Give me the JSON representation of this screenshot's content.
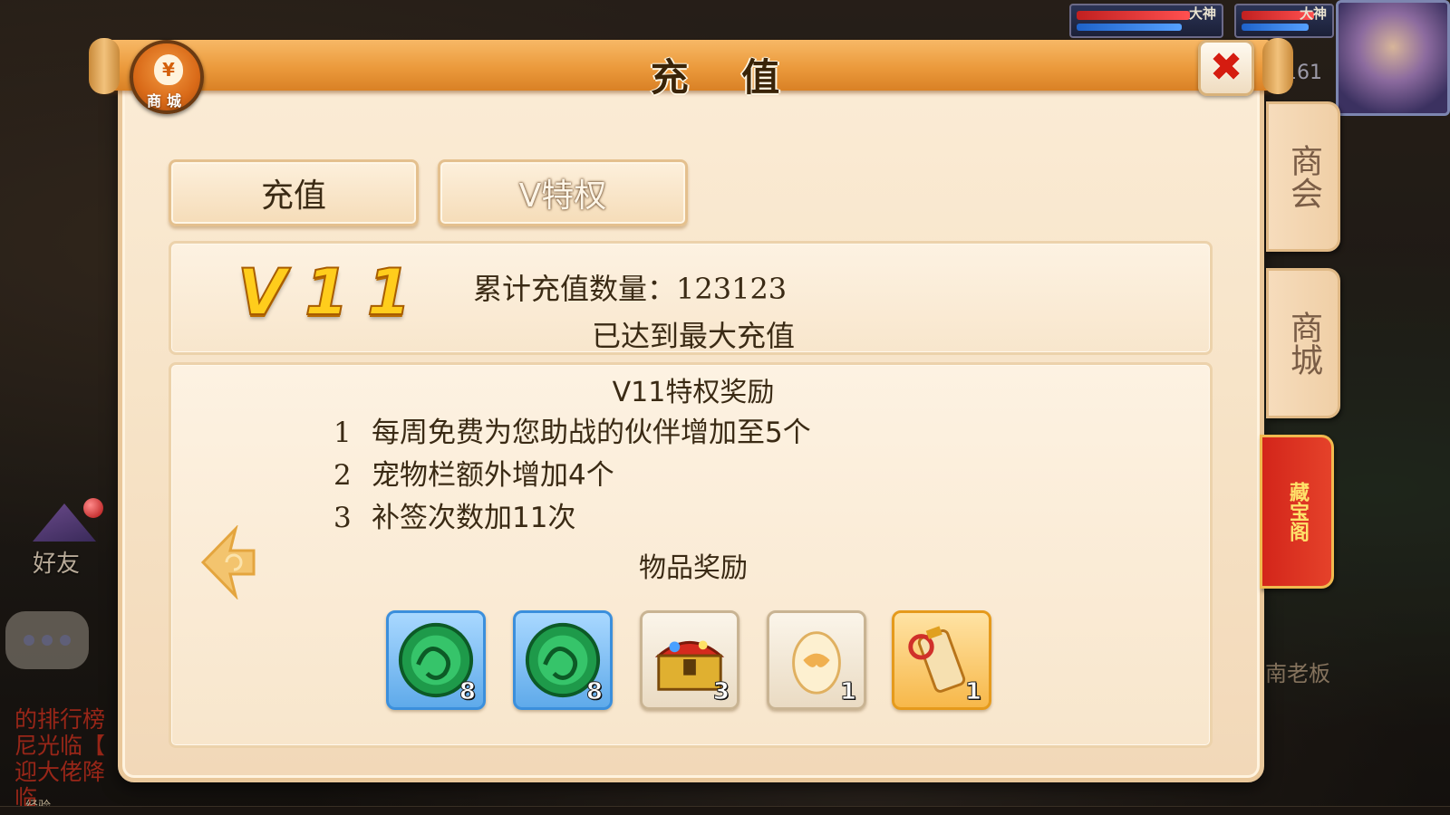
{
  "dialog": {
    "title": "充 值",
    "shop_emblem_label": "商城",
    "shop_emblem_symbol": "¥",
    "close_symbol": "✖"
  },
  "tabs": [
    {
      "label": "充值"
    },
    {
      "label": "V特权"
    }
  ],
  "vip": {
    "level_badge": "V11",
    "cumulative_label": "累计充值数量：123123",
    "max_reached": "已达到最大充值"
  },
  "rewards": {
    "title": "V11特权奖励",
    "privileges": [
      {
        "num": "1",
        "text": "每周免费为您助战的伙伴增加至5个"
      },
      {
        "num": "2",
        "text": "宠物栏额外增加4个"
      },
      {
        "num": "3",
        "text": "补签次数加11次"
      }
    ],
    "items_title": "物品奖励",
    "items": [
      {
        "icon": "jade-dragon-icon",
        "qty": "8",
        "frame": "blue"
      },
      {
        "icon": "jade-dragon-icon",
        "qty": "8",
        "frame": "blue"
      },
      {
        "icon": "treasure-chest-icon",
        "qty": "3",
        "frame": "plain"
      },
      {
        "icon": "pet-egg-icon",
        "qty": "1",
        "frame": "plain"
      },
      {
        "icon": "scroll-icon",
        "qty": "1",
        "frame": "gold"
      }
    ]
  },
  "side_tabs": [
    {
      "label": "商会"
    },
    {
      "label": "商城"
    },
    {
      "label": "藏宝阁"
    }
  ],
  "hud": {
    "friend_label": "好友",
    "level_text": "161",
    "player_tag_1": "大神",
    "player_tag_2": "大神",
    "pet_label": "南老板",
    "exp_label": "经验",
    "chat_log": [
      "的排行榜",
      "尼光临【",
      "迎大佬降临"
    ]
  },
  "colors": {
    "title_bar": "#eb9a3c",
    "panel_bg": "#fbecd6",
    "close_x": "#d51c10",
    "vip_gold": "#ffcd1c",
    "active_side_tab": "#d3251a"
  }
}
